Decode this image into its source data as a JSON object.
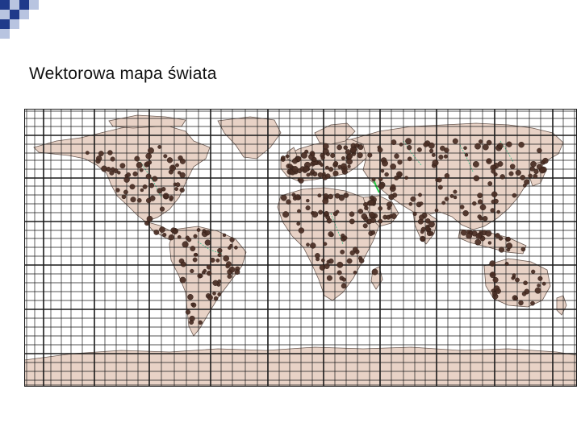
{
  "slide": {
    "title": "Wektorowa mapa świata"
  },
  "map": {
    "kind": "world vector map with graticule grid and point symbols",
    "colors": {
      "ocean": "#ffffff",
      "land": "#e8d2c6",
      "coast": "#6b5a52",
      "grid": "#1a1a1a",
      "points": "#4a2e24",
      "rivers": "#3fbf8c",
      "highlight": "#22cc44",
      "deco_dark": "#1f3a8a",
      "deco_light": "#b8c4e0"
    }
  }
}
